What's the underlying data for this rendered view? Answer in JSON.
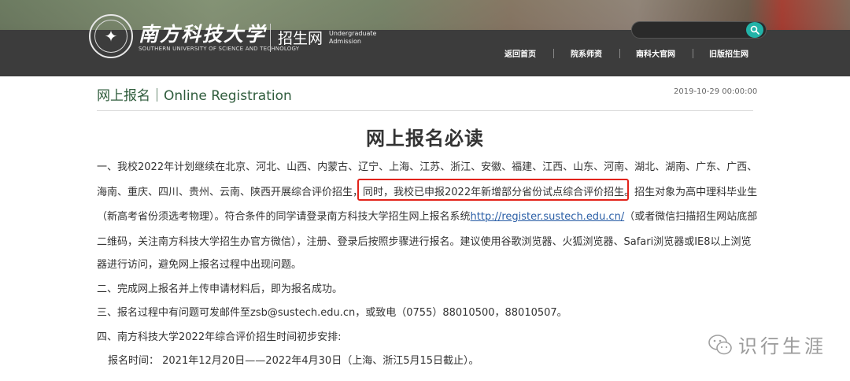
{
  "header": {
    "school_name_cn": "南方科技大学",
    "school_name_en": "SOUTHERN UNIVERSITY OF SCIENCE AND TECHNOLOGY",
    "site_name_cn": "招生网",
    "site_name_en_line1": "Undergraduate",
    "site_name_en_line2": "Admission",
    "search": {
      "value": "",
      "placeholder": ""
    },
    "nav": [
      "返回首页",
      "院系师资",
      "南科大官网",
      "旧版招生网"
    ]
  },
  "page": {
    "section_title": "网上报名｜Online Registration",
    "date": "2019-10-29 00:00:00",
    "article_title": "网上报名必读",
    "paragraphs": {
      "p1_line1": "一、我校2022年计划继续在北京、河北、山西、内蒙古、辽宁、上海、江苏、浙江、安徽、福建、江西、山东、河南、湖北、湖南、广东、广西、",
      "p1_line2_a": "海南、重庆、四川、贵州、云南、陕西开展综合评价招生，",
      "p1_line2_b": "同时，我校已申报2022年新增部分省份试点综合评价招生。",
      "p1_line2_c": "招生对象为高中理科毕业生",
      "p1_line3_a": "（新高考省份须选考物理）。符合条件的同学请登录南方科技大学招生网上报名系统",
      "p1_line3_link": "http://register.sustech.edu.cn/",
      "p1_line3_b": "（或者微信扫描招生网站底部",
      "p1_line4": "二维码，关注南方科技大学招生办官方微信），注册、登录后按照步骤进行报名。建议使用谷歌浏览器、火狐浏览器、Safari浏览器或IE8以上浏览",
      "p1_line5": "器进行访问，避免网上报名过程中出现问题。",
      "p2": "二、完成网上报名并上传申请材料后，即为报名成功。",
      "p3": "三、报名过程中有问题可发邮件至zsb@sustech.edu.cn，或致电（0755）88010500，88010507。",
      "p4": "四、南方科技大学2022年综合评价招生时间初步安排:",
      "p5": "报名时间： 2021年12月20日——2022年4月30日（上海、浙江5月15日截止）。"
    }
  },
  "watermark": {
    "text": "识行生涯"
  },
  "colors": {
    "accent": "#22b3a8",
    "highlight_border": "#e2231a",
    "section_title": "#2f5c3c",
    "link": "#2a5ea6"
  }
}
